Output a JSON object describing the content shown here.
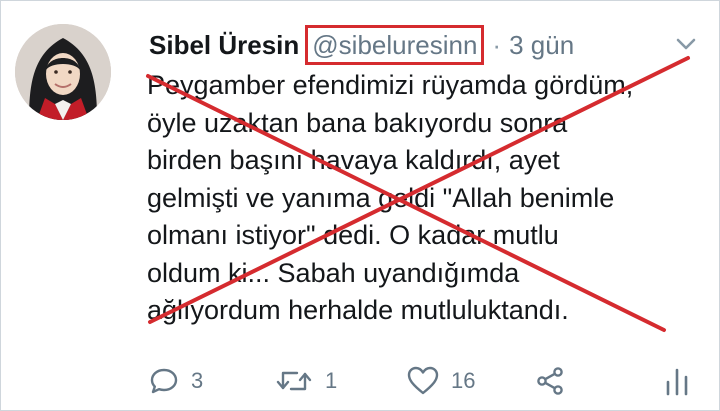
{
  "tweet": {
    "author_name": "Sibel Üresin",
    "handle": "@sibeluresinn",
    "separator": "·",
    "time": "3 gün",
    "text_lines": [
      "Peygamber efendimizi rüyamda gördüm,",
      "öyle uzaktan bana bakıyordu sonra",
      "birden başını havaya kaldırdı, ayet",
      "gelmişti ve yanıma geldi \"Allah benimle",
      "olmanı istiyor\" dedi. O kadar mutlu",
      "oldum ki... Sabah uyandığımda",
      "ağlıyordum herhalde mutluluktandı."
    ],
    "actions": {
      "reply_count": "3",
      "retweet_count": "1",
      "like_count": "16"
    }
  },
  "icons": {
    "caret": "chevron-down-icon",
    "reply": "reply-icon",
    "retweet": "retweet-icon",
    "like": "heart-icon",
    "share": "share-icon",
    "analytics": "analytics-icon"
  },
  "colors": {
    "cross_mark": "#d52b2f",
    "handle_highlight": "#d52b2f",
    "secondary_text": "#657786"
  }
}
